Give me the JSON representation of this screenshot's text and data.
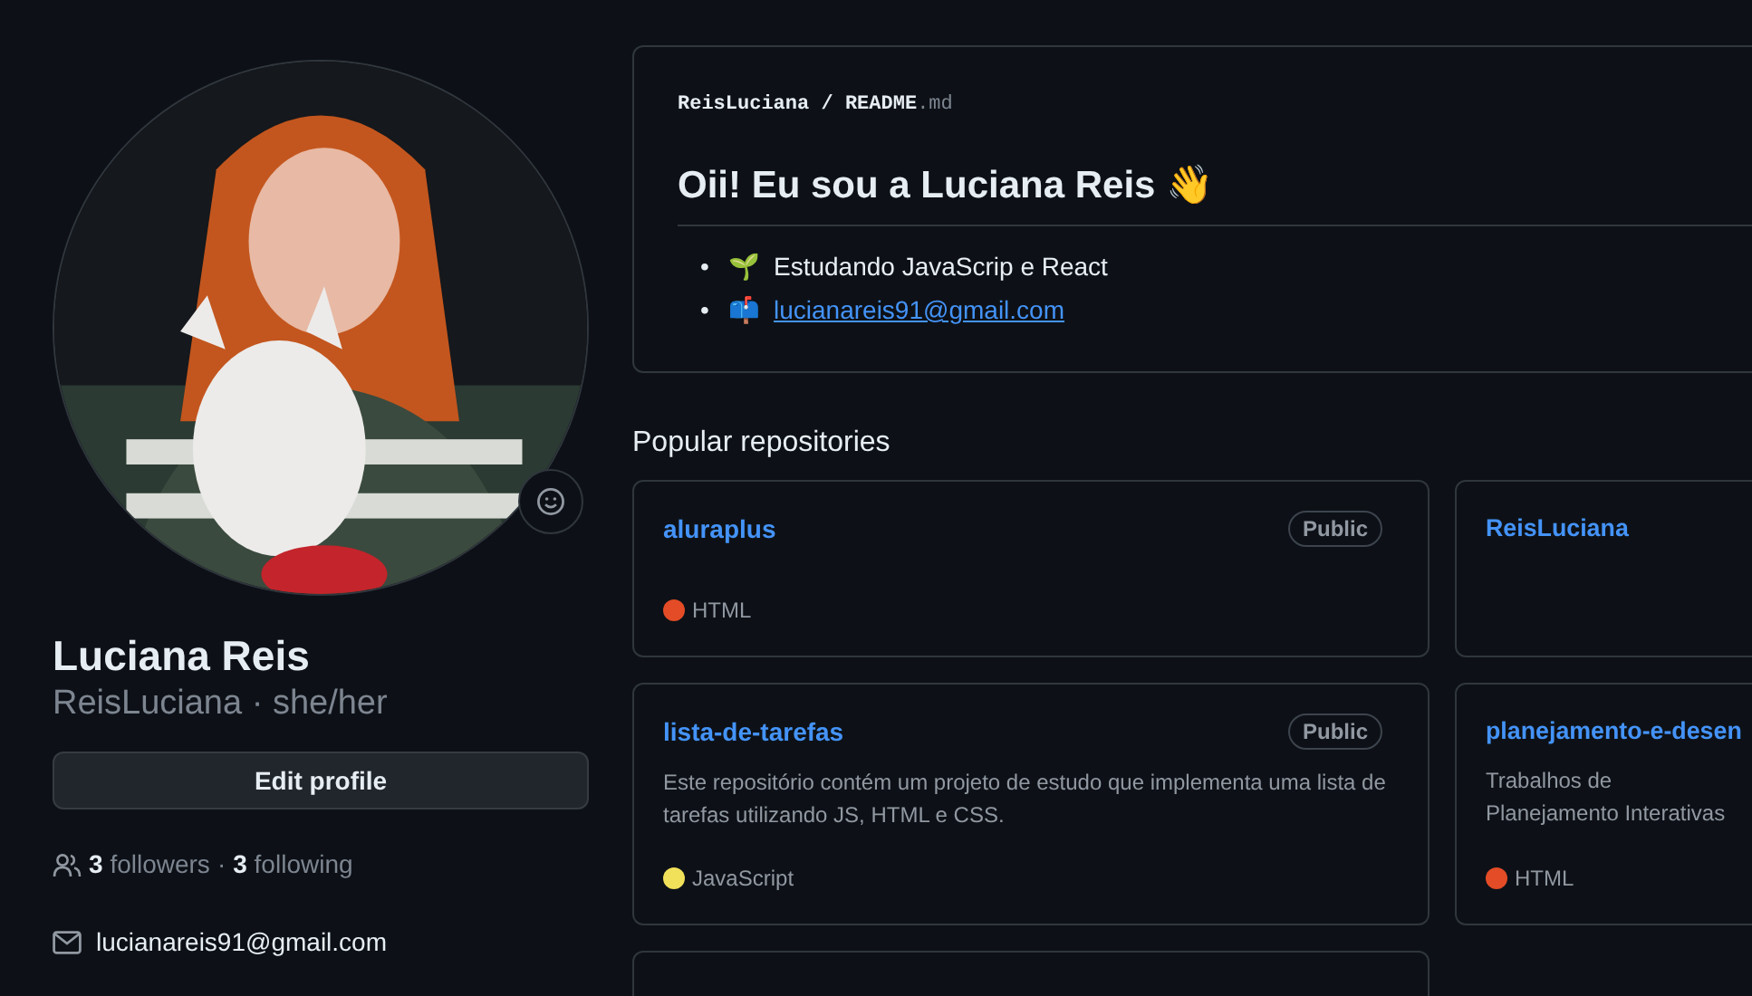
{
  "profile": {
    "name": "Luciana Reis",
    "login": "ReisLuciana · she/her",
    "edit_button": "Edit profile",
    "followers_count": "3",
    "followers_label": "followers",
    "separator": "·",
    "following_count": "3",
    "following_label": "following",
    "email": "lucianareis91@gmail.com"
  },
  "readme": {
    "owner": "ReisLuciana",
    "slash": "/",
    "file": "README",
    "ext": ".md",
    "heading": "Oii! Eu sou a Luciana Reis 👋",
    "items": [
      {
        "kind": "text",
        "bullet": "•",
        "emoji": "🌱",
        "text": "Estudando JavaScrip e React"
      },
      {
        "kind": "link",
        "bullet": "•",
        "emoji": "📫",
        "text": "lucianareis91@gmail.com"
      }
    ]
  },
  "popular": {
    "title": "Popular repositories",
    "repos": [
      {
        "kind": "repo",
        "name": "aluraplus",
        "visibility": "Public",
        "language": "HTML",
        "color": "#e34c26"
      },
      {
        "kind": "repo",
        "name": "ReisLuciana"
      },
      {
        "kind": "repo",
        "name": "lista-de-tarefas",
        "visibility": "Public",
        "description": "Este repositório contém um projeto de estudo que implementa uma lista de tarefas utilizando JS, HTML e CSS.",
        "language": "JavaScript",
        "color": "#f1e05a"
      },
      {
        "kind": "repo",
        "name": "planejamento-e-desen",
        "description": "Trabalhos de Planejamento Interativas",
        "language": "HTML",
        "color": "#e34c26"
      },
      {
        "kind": "partial"
      }
    ]
  }
}
